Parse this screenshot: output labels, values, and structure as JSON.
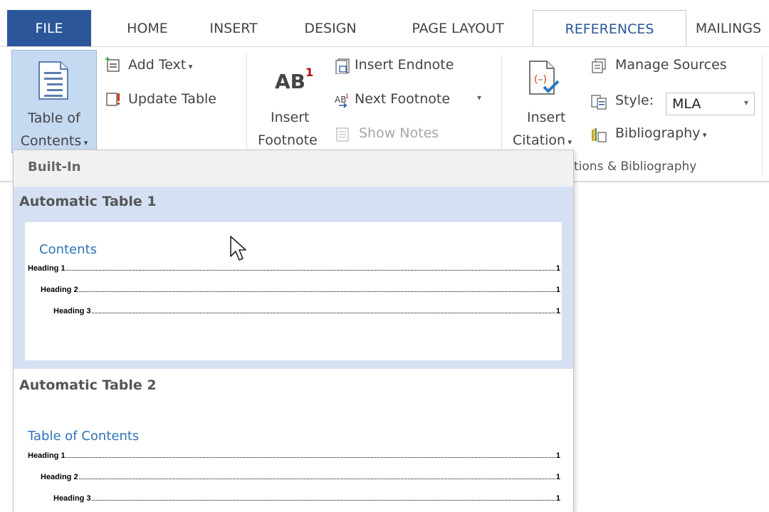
{
  "tabs": {
    "file": "FILE",
    "home": "HOME",
    "insert": "INSERT",
    "design": "DESIGN",
    "page_layout": "PAGE LAYOUT",
    "references": "REFERENCES",
    "mailings": "MAILINGS"
  },
  "ribbon": {
    "toc": {
      "line1": "Table of",
      "line2": "Contents"
    },
    "add_text": "Add Text",
    "update_table": "Update Table",
    "insert_footnote": {
      "icon_text": "AB",
      "superscript": "1",
      "line1": "Insert",
      "line2": "Footnote"
    },
    "insert_endnote": "Insert Endnote",
    "next_footnote": "Next Footnote",
    "show_notes": "Show Notes",
    "insert_citation": {
      "line1": "Insert",
      "line2": "Citation"
    },
    "manage_sources": "Manage Sources",
    "style_label": "Style:",
    "style_value": "MLA",
    "bibliography": "Bibliography",
    "citations_group_label": "tions & Bibliography"
  },
  "dropdown": {
    "section_header": "Built-In",
    "items": [
      {
        "title": "Automatic Table 1",
        "heading": "Contents",
        "rows": [
          {
            "name": "Heading 1",
            "page": "1"
          },
          {
            "name": "Heading 2",
            "page": "1"
          },
          {
            "name": "Heading 3",
            "page": "1"
          }
        ]
      },
      {
        "title": "Automatic Table 2",
        "heading": "Table of Contents",
        "rows": [
          {
            "name": "Heading 1",
            "page": "1"
          },
          {
            "name": "Heading 2",
            "page": "1"
          },
          {
            "name": "Heading 3",
            "page": "1"
          }
        ]
      }
    ]
  },
  "colors": {
    "file_tab": "#2b579a",
    "active_tab_text": "#2b579a",
    "toc_button_highlight": "#c5d9f1",
    "hovered_item": "#d5e1f2",
    "toc_heading": "#2e74b5",
    "footnote_superscript": "#c00000"
  }
}
